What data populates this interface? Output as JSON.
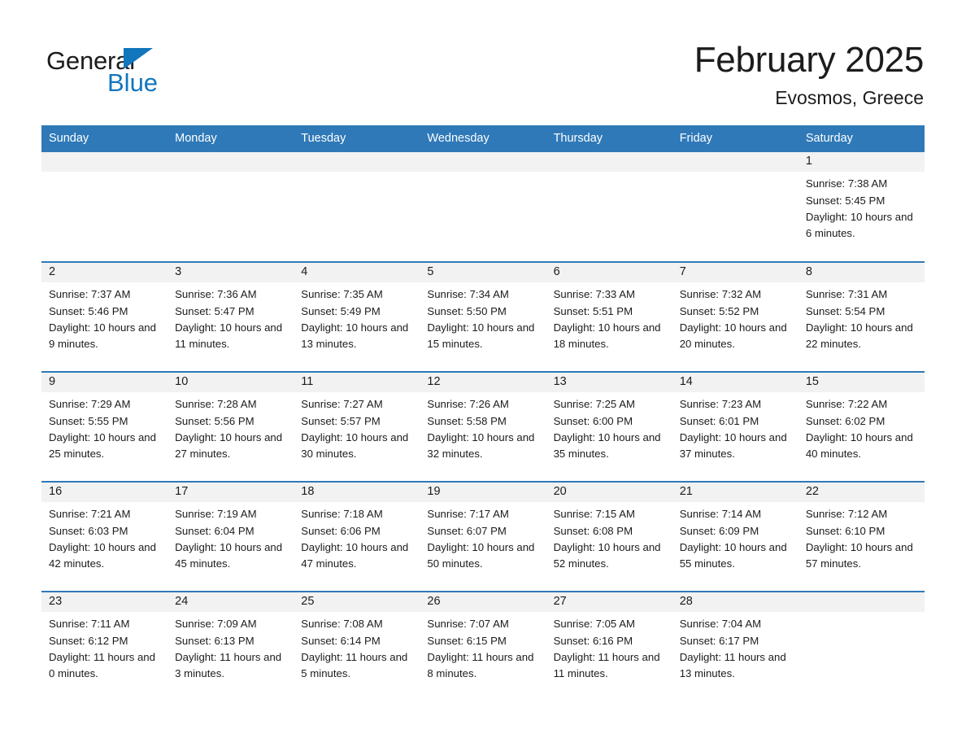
{
  "brand": {
    "word_one": "General",
    "word_two": "Blue",
    "accent_color": "#1276bd",
    "triangle_icon": "brand-triangle-icon"
  },
  "header": {
    "title": "February 2025",
    "location": "Evosmos, Greece"
  },
  "calendar": {
    "header_bg": "#2f79b8",
    "daynum_bg": "#f2f2f2",
    "weekday_labels": [
      "Sunday",
      "Monday",
      "Tuesday",
      "Wednesday",
      "Thursday",
      "Friday",
      "Saturday"
    ],
    "weeks": [
      [
        {
          "day": "",
          "blank": true
        },
        {
          "day": "",
          "blank": true
        },
        {
          "day": "",
          "blank": true
        },
        {
          "day": "",
          "blank": true
        },
        {
          "day": "",
          "blank": true
        },
        {
          "day": "",
          "blank": true
        },
        {
          "day": "1",
          "sunrise": "Sunrise: 7:38 AM",
          "sunset": "Sunset: 5:45 PM",
          "daylight": "Daylight: 10 hours and 6 minutes."
        }
      ],
      [
        {
          "day": "2",
          "sunrise": "Sunrise: 7:37 AM",
          "sunset": "Sunset: 5:46 PM",
          "daylight": "Daylight: 10 hours and 9 minutes."
        },
        {
          "day": "3",
          "sunrise": "Sunrise: 7:36 AM",
          "sunset": "Sunset: 5:47 PM",
          "daylight": "Daylight: 10 hours and 11 minutes."
        },
        {
          "day": "4",
          "sunrise": "Sunrise: 7:35 AM",
          "sunset": "Sunset: 5:49 PM",
          "daylight": "Daylight: 10 hours and 13 minutes."
        },
        {
          "day": "5",
          "sunrise": "Sunrise: 7:34 AM",
          "sunset": "Sunset: 5:50 PM",
          "daylight": "Daylight: 10 hours and 15 minutes."
        },
        {
          "day": "6",
          "sunrise": "Sunrise: 7:33 AM",
          "sunset": "Sunset: 5:51 PM",
          "daylight": "Daylight: 10 hours and 18 minutes."
        },
        {
          "day": "7",
          "sunrise": "Sunrise: 7:32 AM",
          "sunset": "Sunset: 5:52 PM",
          "daylight": "Daylight: 10 hours and 20 minutes."
        },
        {
          "day": "8",
          "sunrise": "Sunrise: 7:31 AM",
          "sunset": "Sunset: 5:54 PM",
          "daylight": "Daylight: 10 hours and 22 minutes."
        }
      ],
      [
        {
          "day": "9",
          "sunrise": "Sunrise: 7:29 AM",
          "sunset": "Sunset: 5:55 PM",
          "daylight": "Daylight: 10 hours and 25 minutes."
        },
        {
          "day": "10",
          "sunrise": "Sunrise: 7:28 AM",
          "sunset": "Sunset: 5:56 PM",
          "daylight": "Daylight: 10 hours and 27 minutes."
        },
        {
          "day": "11",
          "sunrise": "Sunrise: 7:27 AM",
          "sunset": "Sunset: 5:57 PM",
          "daylight": "Daylight: 10 hours and 30 minutes."
        },
        {
          "day": "12",
          "sunrise": "Sunrise: 7:26 AM",
          "sunset": "Sunset: 5:58 PM",
          "daylight": "Daylight: 10 hours and 32 minutes."
        },
        {
          "day": "13",
          "sunrise": "Sunrise: 7:25 AM",
          "sunset": "Sunset: 6:00 PM",
          "daylight": "Daylight: 10 hours and 35 minutes."
        },
        {
          "day": "14",
          "sunrise": "Sunrise: 7:23 AM",
          "sunset": "Sunset: 6:01 PM",
          "daylight": "Daylight: 10 hours and 37 minutes."
        },
        {
          "day": "15",
          "sunrise": "Sunrise: 7:22 AM",
          "sunset": "Sunset: 6:02 PM",
          "daylight": "Daylight: 10 hours and 40 minutes."
        }
      ],
      [
        {
          "day": "16",
          "sunrise": "Sunrise: 7:21 AM",
          "sunset": "Sunset: 6:03 PM",
          "daylight": "Daylight: 10 hours and 42 minutes."
        },
        {
          "day": "17",
          "sunrise": "Sunrise: 7:19 AM",
          "sunset": "Sunset: 6:04 PM",
          "daylight": "Daylight: 10 hours and 45 minutes."
        },
        {
          "day": "18",
          "sunrise": "Sunrise: 7:18 AM",
          "sunset": "Sunset: 6:06 PM",
          "daylight": "Daylight: 10 hours and 47 minutes."
        },
        {
          "day": "19",
          "sunrise": "Sunrise: 7:17 AM",
          "sunset": "Sunset: 6:07 PM",
          "daylight": "Daylight: 10 hours and 50 minutes."
        },
        {
          "day": "20",
          "sunrise": "Sunrise: 7:15 AM",
          "sunset": "Sunset: 6:08 PM",
          "daylight": "Daylight: 10 hours and 52 minutes."
        },
        {
          "day": "21",
          "sunrise": "Sunrise: 7:14 AM",
          "sunset": "Sunset: 6:09 PM",
          "daylight": "Daylight: 10 hours and 55 minutes."
        },
        {
          "day": "22",
          "sunrise": "Sunrise: 7:12 AM",
          "sunset": "Sunset: 6:10 PM",
          "daylight": "Daylight: 10 hours and 57 minutes."
        }
      ],
      [
        {
          "day": "23",
          "sunrise": "Sunrise: 7:11 AM",
          "sunset": "Sunset: 6:12 PM",
          "daylight": "Daylight: 11 hours and 0 minutes."
        },
        {
          "day": "24",
          "sunrise": "Sunrise: 7:09 AM",
          "sunset": "Sunset: 6:13 PM",
          "daylight": "Daylight: 11 hours and 3 minutes."
        },
        {
          "day": "25",
          "sunrise": "Sunrise: 7:08 AM",
          "sunset": "Sunset: 6:14 PM",
          "daylight": "Daylight: 11 hours and 5 minutes."
        },
        {
          "day": "26",
          "sunrise": "Sunrise: 7:07 AM",
          "sunset": "Sunset: 6:15 PM",
          "daylight": "Daylight: 11 hours and 8 minutes."
        },
        {
          "day": "27",
          "sunrise": "Sunrise: 7:05 AM",
          "sunset": "Sunset: 6:16 PM",
          "daylight": "Daylight: 11 hours and 11 minutes."
        },
        {
          "day": "28",
          "sunrise": "Sunrise: 7:04 AM",
          "sunset": "Sunset: 6:17 PM",
          "daylight": "Daylight: 11 hours and 13 minutes."
        },
        {
          "day": "",
          "blank": true
        }
      ]
    ]
  }
}
